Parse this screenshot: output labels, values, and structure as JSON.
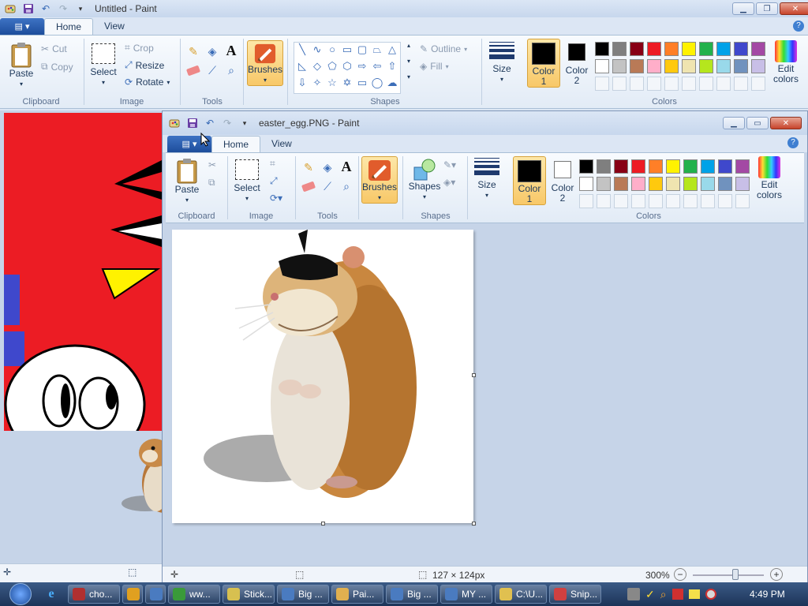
{
  "back_window": {
    "title": "Untitled - Paint",
    "tabs": [
      "Home",
      "View"
    ],
    "clipboard": {
      "paste": "Paste",
      "cut": "Cut",
      "copy": "Copy",
      "label": "Clipboard"
    },
    "image": {
      "select": "Select",
      "crop": "Crop",
      "resize": "Resize",
      "rotate": "Rotate",
      "label": "Image"
    },
    "tools": {
      "label": "Tools"
    },
    "brushes": "Brushes",
    "shapes": {
      "outline": "Outline",
      "fill": "Fill",
      "label": "Shapes"
    },
    "size": "Size",
    "color1": "Color\n1",
    "color2": "Color\n2",
    "edit_colors": "Edit\ncolors",
    "colors_label": "Colors"
  },
  "front_window": {
    "title": "easter_egg.PNG - Paint",
    "tabs": [
      "Home",
      "View"
    ],
    "clipboard": {
      "paste": "Paste",
      "label": "Clipboard"
    },
    "image": {
      "select": "Select",
      "label": "Image"
    },
    "tools": {
      "label": "Tools"
    },
    "brushes": "Brushes",
    "shapes": {
      "button": "Shapes",
      "label": "Shapes"
    },
    "size": "Size",
    "color1": "Color\n1",
    "color2": "Color\n2",
    "edit_colors": "Edit\ncolors",
    "colors_label": "Colors",
    "status": {
      "dimensions": "127 × 124px",
      "zoom": "300%"
    }
  },
  "palette": {
    "row1": [
      "#000000",
      "#7f7f7f",
      "#880015",
      "#ed1c24",
      "#ff7f27",
      "#fff200",
      "#22b14c",
      "#00a2e8",
      "#3f48cc",
      "#a349a4"
    ],
    "row2": [
      "#ffffff",
      "#c3c3c3",
      "#b97a57",
      "#ffaec9",
      "#ffc90e",
      "#efe4b0",
      "#b5e61d",
      "#99d9ea",
      "#7092be",
      "#c8bfe7"
    ]
  },
  "taskbar": {
    "items": [
      {
        "label": "cho...",
        "icon_color": "#b03030"
      },
      {
        "label": "",
        "icon_color": "#e0a020"
      },
      {
        "label": "",
        "icon_color": "#4a7bc0"
      },
      {
        "label": "ww...",
        "icon_color": "#3a9a3a"
      },
      {
        "label": "Stick...",
        "icon_color": "#d7c050"
      },
      {
        "label": "Big ...",
        "icon_color": "#4a7bc0"
      },
      {
        "label": "Pai...",
        "icon_color": "#e0b050"
      },
      {
        "label": "Big ...",
        "icon_color": "#4a7bc0"
      },
      {
        "label": "MY ...",
        "icon_color": "#4a7bc0"
      },
      {
        "label": "C:\\U...",
        "icon_color": "#e0c050"
      },
      {
        "label": "Snip...",
        "icon_color": "#d04040"
      }
    ],
    "clock": "4:49 PM"
  }
}
